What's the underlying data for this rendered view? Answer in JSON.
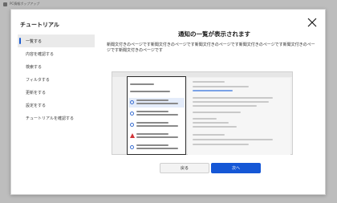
{
  "background_window": {
    "title": "PC情報ポップアップ"
  },
  "dialog": {
    "title": "チュートリアル",
    "close_icon": "close-icon"
  },
  "sidebar": {
    "items": [
      {
        "label": "一覧する",
        "active": true
      },
      {
        "label": "内容を確認する",
        "active": false
      },
      {
        "label": "検索する",
        "active": false
      },
      {
        "label": "フィルタする",
        "active": false
      },
      {
        "label": "更新をする",
        "active": false
      },
      {
        "label": "設定をする",
        "active": false
      },
      {
        "label": "チュートリアルを確認する",
        "active": false
      }
    ]
  },
  "main": {
    "heading": "通知の一覧が表示されます",
    "description": "新聞文付きのページです新聞文付きのページです新聞文付きのページです新聞文付きのページです新聞文付きのページです新聞文付きのページです"
  },
  "buttons": {
    "back_label": "戻る",
    "next_label": "次へ"
  },
  "colors": {
    "accent": "#1557d6",
    "warning": "#d13438"
  }
}
